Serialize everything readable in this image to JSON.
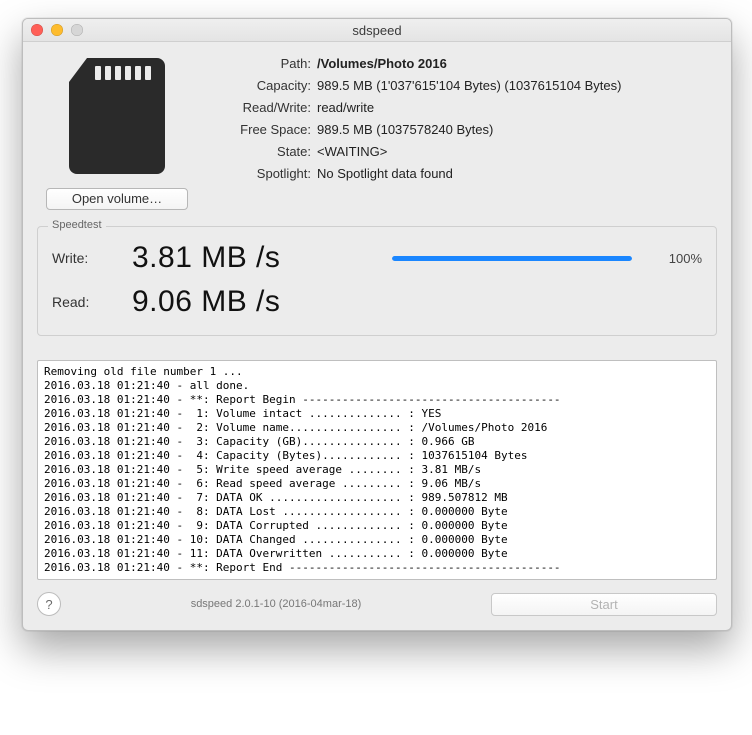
{
  "window": {
    "title": "sdspeed"
  },
  "buttons": {
    "open_volume": "Open volume…",
    "start": "Start"
  },
  "info": {
    "path_label": "Path:",
    "path_value": "/Volumes/Photo 2016",
    "capacity_label": "Capacity:",
    "capacity_value": "989.5 MB (1'037'615'104 Bytes) (1037615104 Bytes)",
    "rw_label": "Read/Write:",
    "rw_value": "read/write",
    "free_label": "Free Space:",
    "free_value": "989.5 MB (1037578240 Bytes)",
    "state_label": "State:",
    "state_value": "<WAITING>",
    "spotlight_label": "Spotlight:",
    "spotlight_value": "No Spotlight data found"
  },
  "speedtest": {
    "legend": "Speedtest",
    "write_label": "Write:",
    "write_value": "3.81 MB /s",
    "read_label": "Read:",
    "read_value": "9.06 MB /s",
    "progress_pct": 100,
    "progress_text": "100%"
  },
  "log": "Removing old file number 1 ...\n2016.03.18 01:21:40 - all done.\n2016.03.18 01:21:40 - **: Report Begin ---------------------------------------\n2016.03.18 01:21:40 -  1: Volume intact .............. : YES\n2016.03.18 01:21:40 -  2: Volume name................. : /Volumes/Photo 2016\n2016.03.18 01:21:40 -  3: Capacity (GB)............... : 0.966 GB\n2016.03.18 01:21:40 -  4: Capacity (Bytes)............ : 1037615104 Bytes\n2016.03.18 01:21:40 -  5: Write speed average ........ : 3.81 MB/s\n2016.03.18 01:21:40 -  6: Read speed average ......... : 9.06 MB/s\n2016.03.18 01:21:40 -  7: DATA OK .................... : 989.507812 MB\n2016.03.18 01:21:40 -  8: DATA Lost .................. : 0.000000 Byte\n2016.03.18 01:21:40 -  9: DATA Corrupted ............. : 0.000000 Byte\n2016.03.18 01:21:40 - 10: DATA Changed ............... : 0.000000 Byte\n2016.03.18 01:21:40 - 11: DATA Overwritten ........... : 0.000000 Byte\n2016.03.18 01:21:40 - **: Report End -----------------------------------------",
  "footer": {
    "version": "sdspeed 2.0.1-10 (2016-04mar-18)",
    "help_tooltip": "Help"
  }
}
